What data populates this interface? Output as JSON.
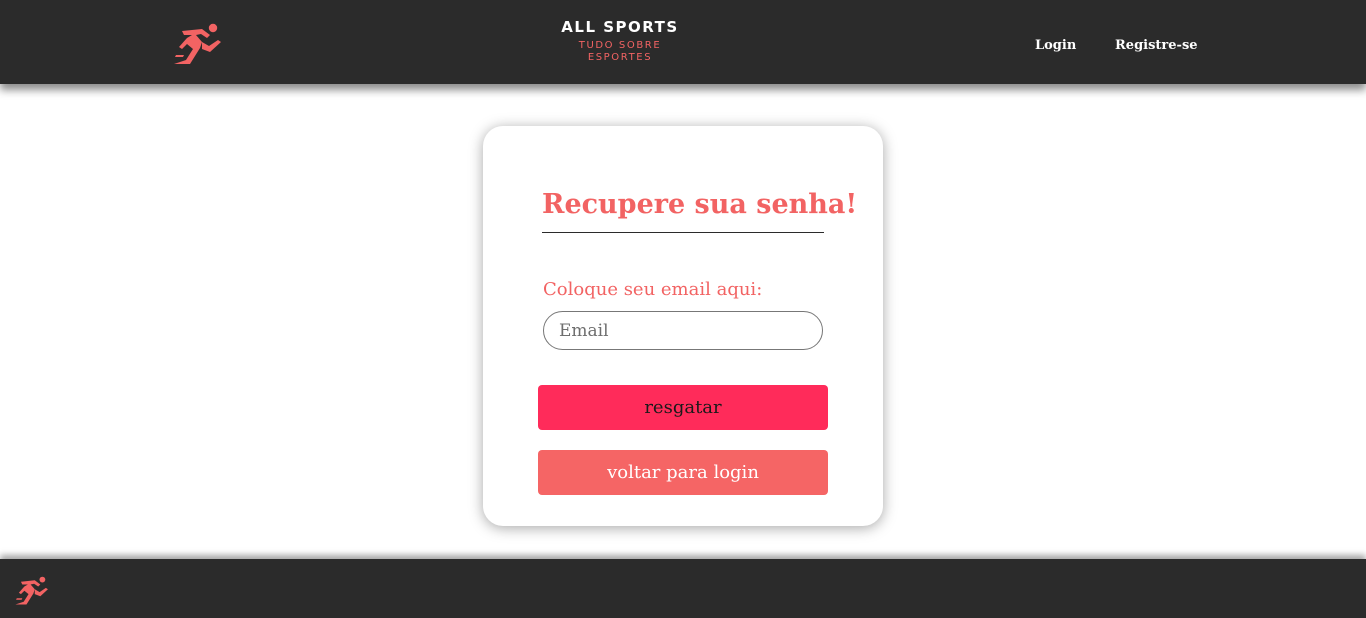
{
  "colors": {
    "accent": "#f26363",
    "header_bg": "#2b2b2b",
    "rescue_button": "#ff2b5a",
    "back_button": "#f56565"
  },
  "header": {
    "logo_icon": "runner-icon",
    "brand_title": "ALL SPORTS",
    "brand_subtitle": "TUDO SOBRE ESPORTES",
    "nav": {
      "login": "Login",
      "register": "Registre-se"
    }
  },
  "card": {
    "title": "Recupere sua senha!",
    "email_label": "Coloque seu email aqui:",
    "email_placeholder": "Email",
    "email_value": "",
    "rescue_button": "resgatar",
    "back_button": "voltar para login"
  },
  "footer": {
    "logo_icon": "runner-icon"
  }
}
